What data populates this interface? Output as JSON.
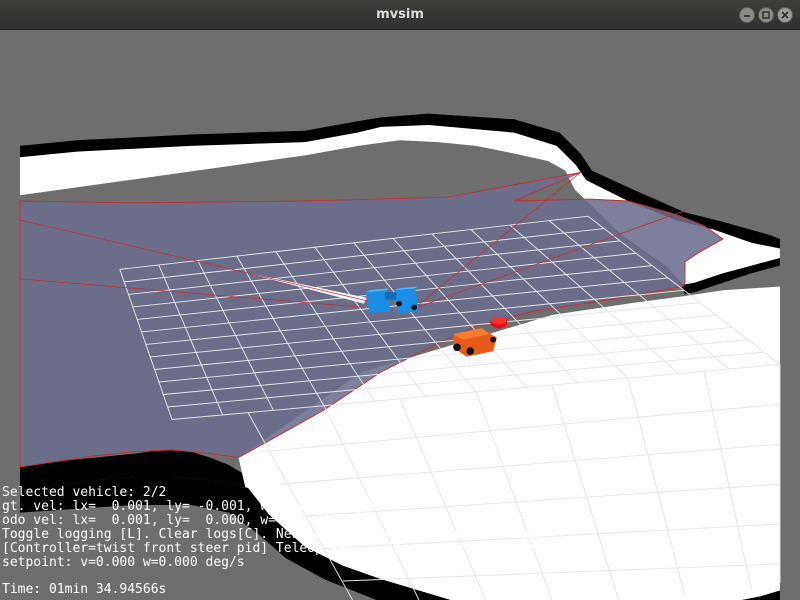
{
  "window": {
    "title": "mvsim"
  },
  "hud": {
    "line1": "Selected vehicle: 2/2",
    "line2": "gt. vel: lx=  0.001, ly= -0.001, w=   0.094deg/s",
    "line3": "odo vel: lx=  0.001, ly=  0.000, w=   0.094deg/s",
    "line4": "Toggle logging [L]. Clear logs[C]. New log session [N]. Now not logging",
    "line5": "[Controller=twist front steer pid] Teleop keys: w/s=incr/decr lin speed. a/d=left/righ",
    "line6": "setpoint: v=0.000 w=0.000 deg/s",
    "line7": "Time: 01min 34.94566s"
  },
  "colors": {
    "background": "#6e6e6e",
    "floor": "#ffffff",
    "obstacle": "#000000",
    "laser_scan": "#6c6d8c",
    "laser_border": "#c03030",
    "grid": "#e6e6e6",
    "robot_selected": "#e85a1a",
    "robot_other": "#1e90e8",
    "marker": "#e0101a"
  },
  "icons": {
    "minimize": "minimize-icon",
    "maximize": "maximize-icon",
    "close": "close-icon"
  }
}
